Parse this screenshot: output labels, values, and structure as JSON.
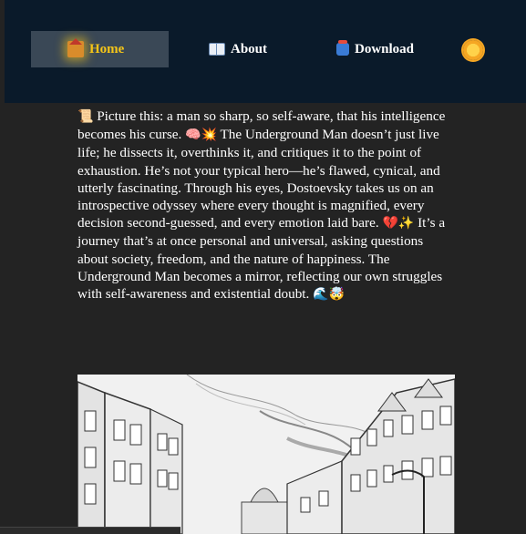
{
  "nav": {
    "home_label": "Home",
    "about_label": "About",
    "download_label": "Download",
    "active": "Home"
  },
  "article": {
    "text_1": "Picture this: a man so sharp, so self-aware, that his intelligence becomes his curse.",
    "text_2": "The Underground Man doesn’t just live life; he dissects it, overthinks it, and critiques it to the point of exhaustion. He’s not your typical hero—he’s flawed, cynical, and utterly fascinating. Through his eyes, Dostoevsky takes us on an introspective odyssey where every thought is magnified, every decision second-guessed, and every emotion laid bare.",
    "text_3": "It’s a journey that’s at once personal and universal, asking questions about society, freedom, and the nature of happiness. The Underground Man becomes a mirror, reflecting our own struggles with self-awareness and existential doubt.",
    "emoji_1": "📜",
    "emoji_2": "🧠💥",
    "emoji_3": "💔✨",
    "emoji_4": "🌊🤯"
  },
  "colors": {
    "page_bg": "#232323",
    "nav_bg": "#0a1a2a",
    "active_tab_bg": "#3a4856",
    "active_text": "#f5c518",
    "text": "#ffffff"
  },
  "icons": {
    "home": "house-icon",
    "about": "open-book-icon",
    "download": "download-box-icon",
    "theme": "sun-icon"
  }
}
